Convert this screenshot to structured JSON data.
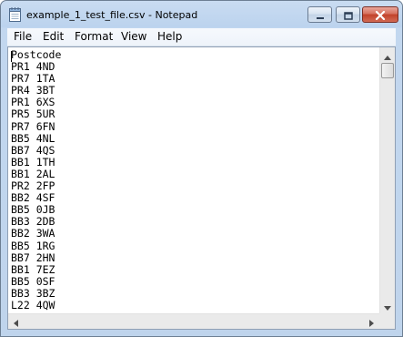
{
  "window": {
    "title": "example_1_test_file.csv - Notepad"
  },
  "menu": {
    "items": [
      {
        "label": "File"
      },
      {
        "label": "Edit"
      },
      {
        "label": "Format"
      },
      {
        "label": "View"
      },
      {
        "label": "Help"
      }
    ]
  },
  "editor": {
    "lines": [
      "Postcode",
      "PR1 4ND",
      "PR7 1TA",
      "PR4 3BT",
      "PR1 6XS",
      "PR5 5UR",
      "PR7 6FN",
      "BB5 4NL",
      "BB7 4QS",
      "BB1 1TH",
      "BB1 2AL",
      "PR2 2FP",
      "BB2 4SF",
      "BB5 0JB",
      "BB3 2DB",
      "BB2 3WA",
      "BB5 1RG",
      "BB7 2HN",
      "BB1 7EZ",
      "BB5 0SF",
      "BB3 3BZ",
      "L22 4QW"
    ]
  },
  "icons": {
    "app": "notepad-icon",
    "minimize": "minimize-icon",
    "maximize": "maximize-icon",
    "close": "close-icon",
    "scroll_up": "arrow-up-icon",
    "scroll_down": "arrow-down-icon",
    "scroll_left": "arrow-left-icon",
    "scroll_right": "arrow-right-icon"
  },
  "colors": {
    "titlebar": "#c9dcf1",
    "close_button": "#c2412a",
    "editor_background": "#ffffff",
    "text": "#000000"
  }
}
